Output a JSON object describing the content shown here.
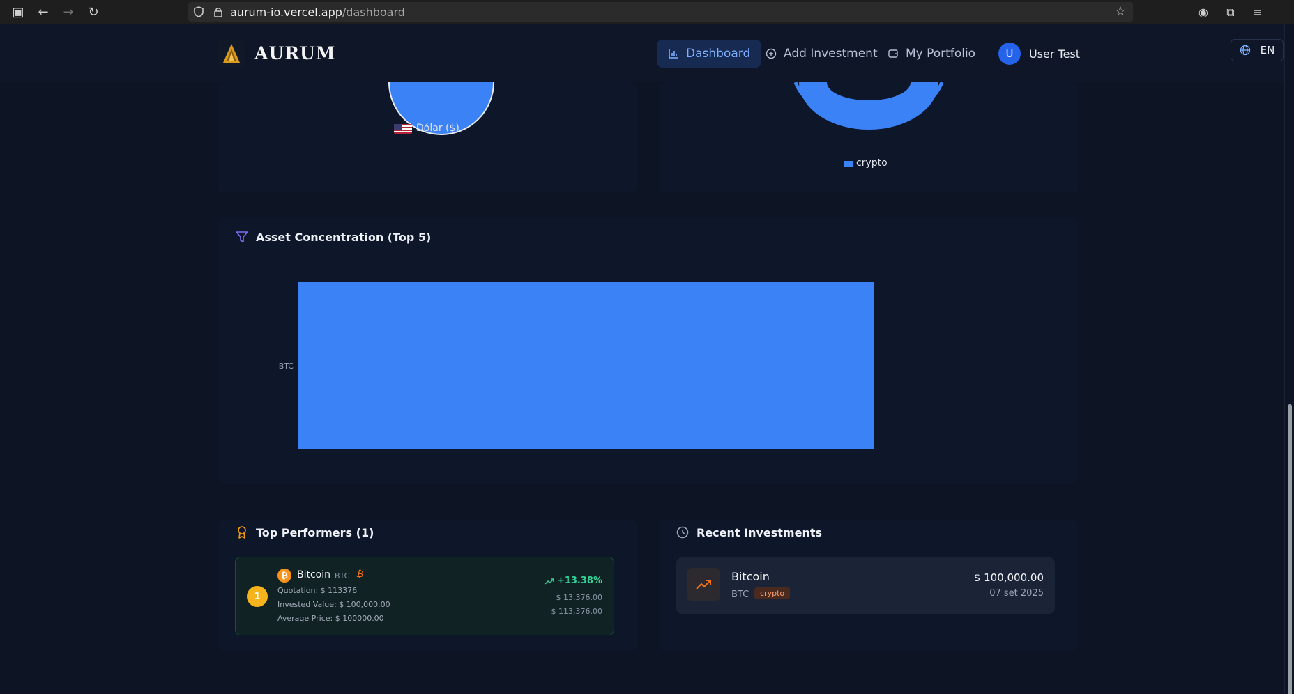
{
  "browser": {
    "url_host": "aurum-io.vercel.app",
    "url_path": "/dashboard"
  },
  "header": {
    "brand": "AURUM",
    "nav": [
      {
        "label": "Dashboard",
        "icon": "bar-chart-icon",
        "active": true
      },
      {
        "label": "Add Investment",
        "icon": "plus-circle-icon",
        "active": false
      },
      {
        "label": "My Portfolio",
        "icon": "wallet-icon",
        "active": false
      }
    ],
    "user": {
      "initial": "U",
      "name": "User Test"
    },
    "language": "EN"
  },
  "currency_chart": {
    "legend_label": "Dólar ($)",
    "color": "#3b82f6"
  },
  "type_chart": {
    "legend_label": "crypto",
    "color": "#3b82f6"
  },
  "asset_concentration": {
    "title": "Asset Concentration (Top 5)",
    "icon": "filter-icon"
  },
  "chart_data": {
    "type": "bar",
    "orientation": "horizontal",
    "categories": [
      "BTC"
    ],
    "values": [
      100
    ],
    "xlabel": "",
    "ylabel": "",
    "grid": false,
    "color": "#3b82f6"
  },
  "top_performers": {
    "title": "Top Performers (1)",
    "icon": "award-icon",
    "items": [
      {
        "rank": "1",
        "name": "Bitcoin",
        "symbol": "BTC",
        "quotation": "Quotation: $ 113376",
        "invested": "Invested Value: $ 100,000.00",
        "average": "Average Price: $ 100000.00",
        "change": "+13.38%",
        "gain": "$ 13,376.00",
        "current": "$ 113,376.00"
      }
    ]
  },
  "recent_investments": {
    "title": "Recent Investments",
    "icon": "clock-icon",
    "items": [
      {
        "name": "Bitcoin",
        "symbol": "BTC",
        "tag": "crypto",
        "amount": "$ 100,000.00",
        "date": "07 set 2025"
      }
    ]
  },
  "colors": {
    "background": "#0d1424",
    "accent": "#3b82f6",
    "positive": "#34d399",
    "gold": "#f5b31c"
  }
}
